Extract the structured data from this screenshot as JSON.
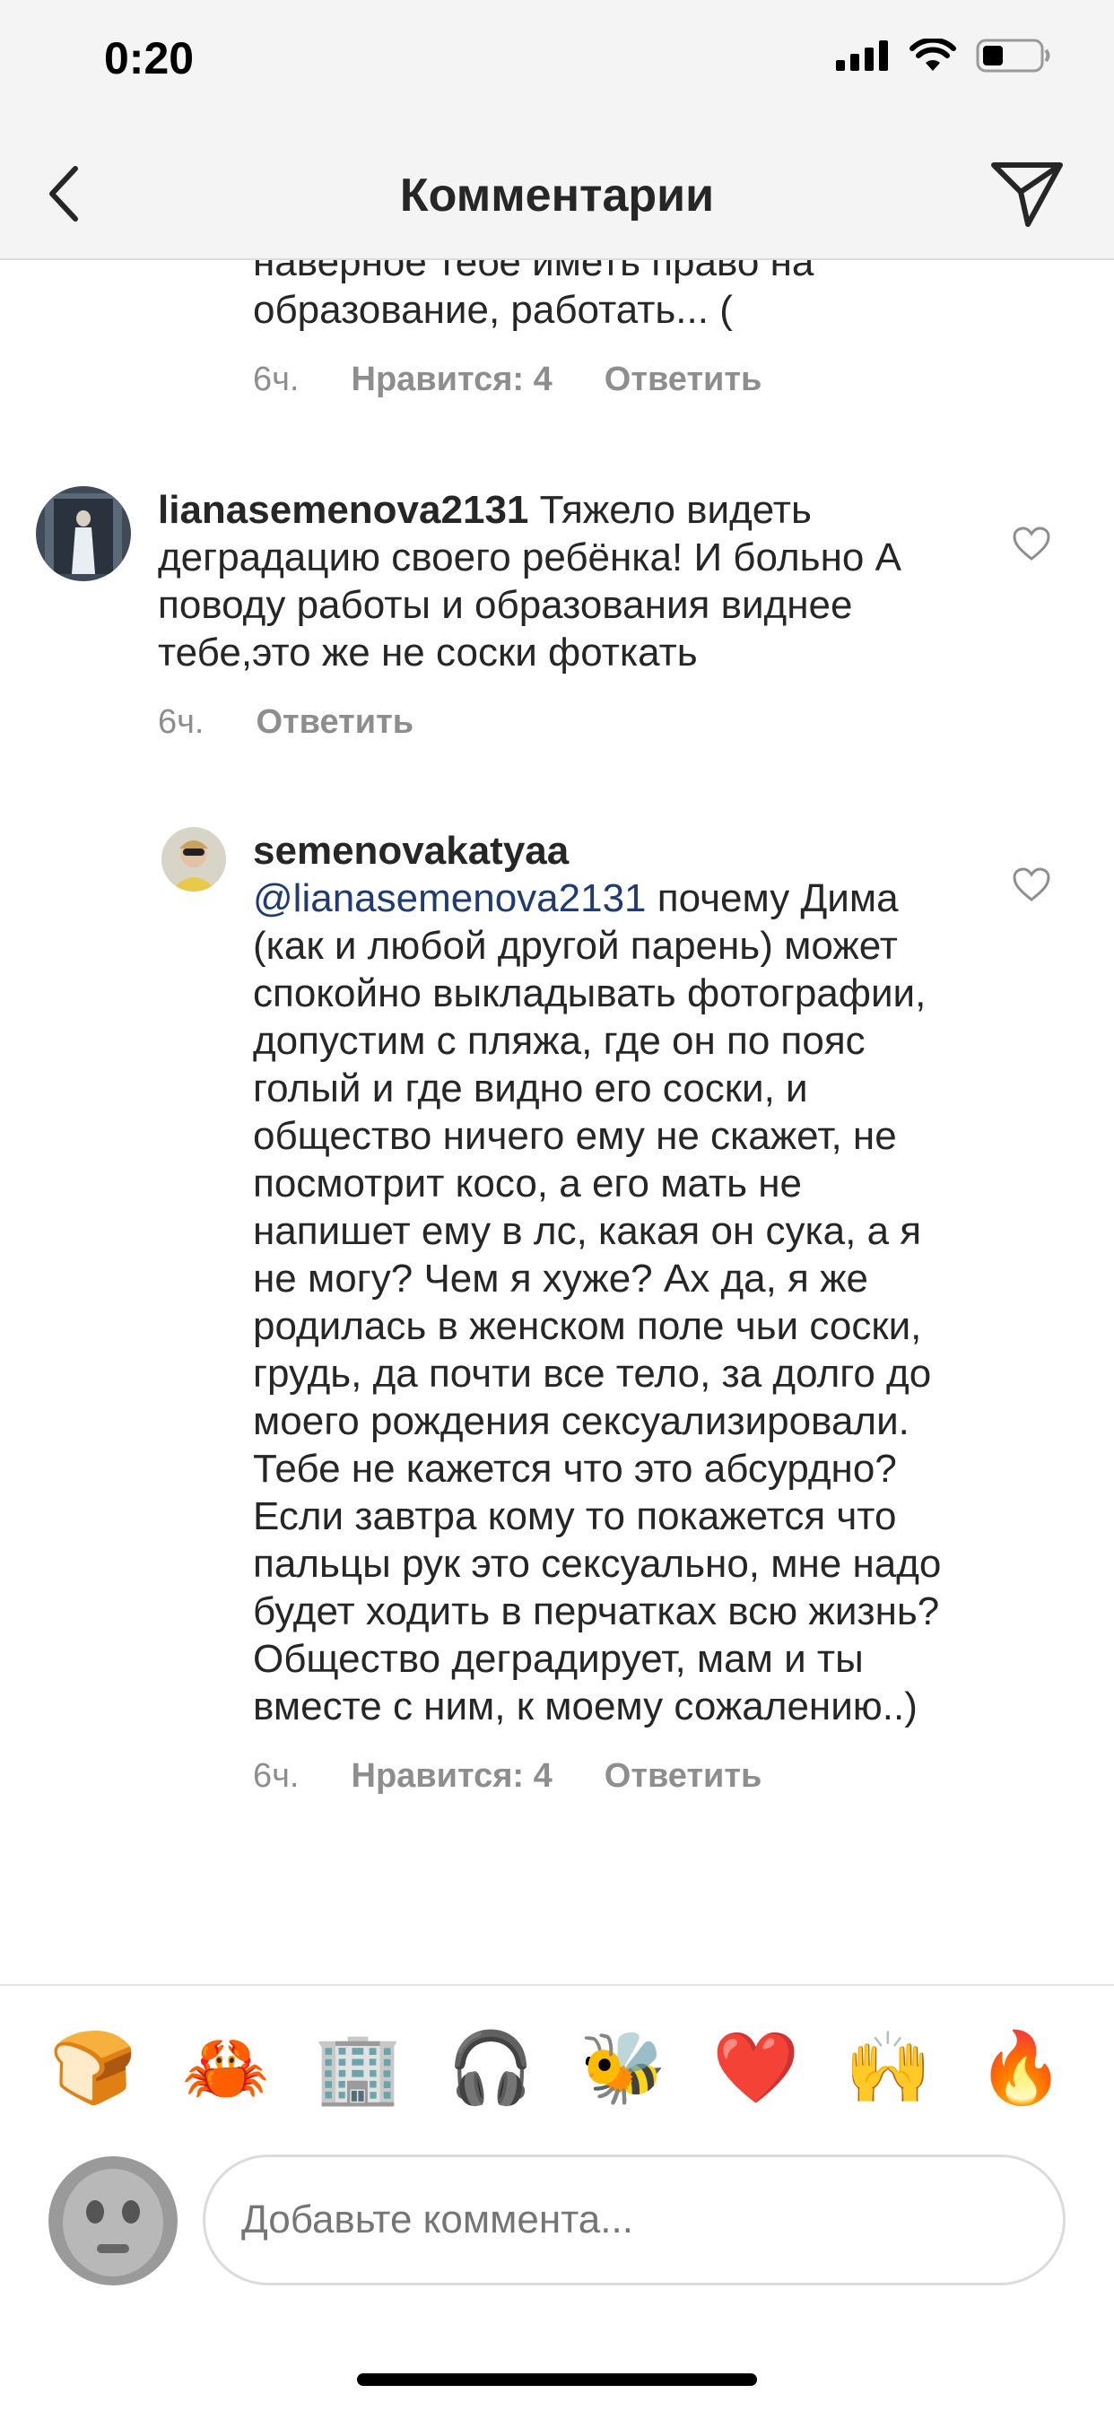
{
  "status_bar": {
    "time": "0:20"
  },
  "header": {
    "title": "Комментарии"
  },
  "comments": [
    {
      "text": "наверное тебе иметь право на образование, работать... (",
      "time": "6ч.",
      "likes": "Нравится: 4",
      "reply": "Ответить"
    },
    {
      "username": "lianasemenova2131",
      "text": " Тяжело видеть деградацию своего ребёнка! И больно А поводу работы и образования виднее тебе,это же не соски фоткать",
      "time": "6ч.",
      "reply": "Ответить"
    },
    {
      "username": "semenovakatyaa",
      "mention": "@lianasemenova2131",
      "text": "  почему Дима (как и любой другой парень) может спокойно выкладывать фотографии, допустим с пляжа, где он по пояс голый и где видно его соски, и общество ничего ему не скажет, не посмотрит косо, а его мать не напишет ему в лс, какая он сука, а я не могу? Чем я хуже? Ах да, я же родилась в женском поле чьи соски, грудь, да почти все тело, за долго до моего рождения сексуализировали. Тебе не кажется что это абсурдно? Если завтра кому то покажется что пальцы рук это сексуально, мне надо будет ходить в перчатках всю жизнь? Общество деградирует, мам и ты вместе с ним, к моему сожалению..)",
      "time": "6ч.",
      "likes": "Нравится: 4",
      "reply": "Ответить"
    }
  ],
  "emoji_bar": [
    "🍞",
    "🦀",
    "🏢",
    "🎧",
    "🐝",
    "❤️",
    "🙌",
    "🔥"
  ],
  "composer": {
    "placeholder": "Добавьте коммента..."
  }
}
